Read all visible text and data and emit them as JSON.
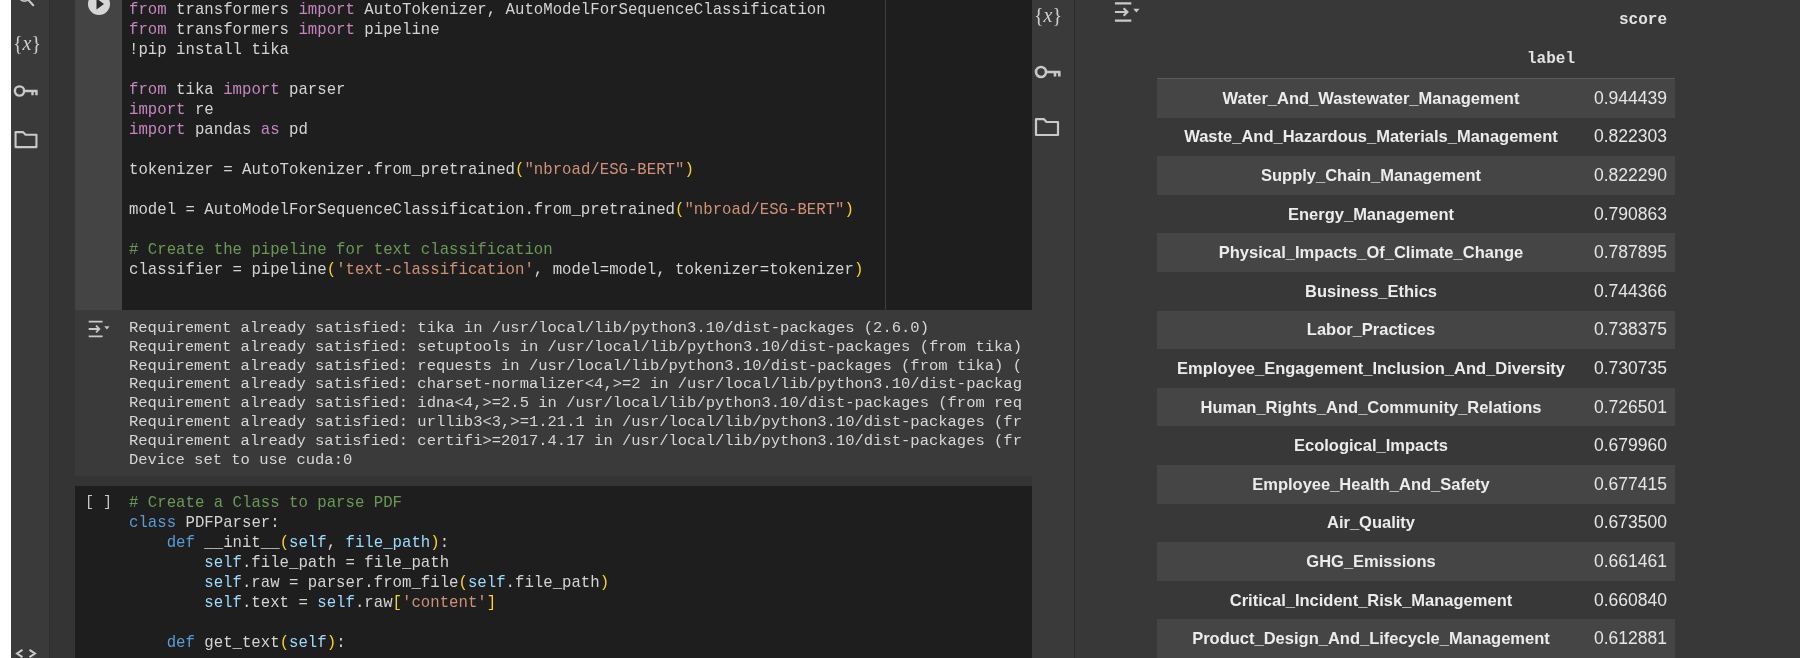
{
  "left_sidebar": {
    "variables_button": "{*x*}"
  },
  "cells": [
    {
      "focused": true,
      "code_lines": [
        {
          "kind": "code",
          "tokens": [
            {
              "kind": "keyword",
              "text": "from"
            },
            {
              "kind": "plain",
              "text": " transformers "
            },
            {
              "kind": "keyword",
              "text": "import"
            },
            {
              "kind": "plain",
              "text": " AutoTokenizer, AutoModelForSequenceClassification"
            }
          ]
        },
        {
          "kind": "code",
          "tokens": [
            {
              "kind": "keyword",
              "text": "from"
            },
            {
              "kind": "plain",
              "text": " transformers "
            },
            {
              "kind": "keyword",
              "text": "import"
            },
            {
              "kind": "plain",
              "text": " pipeline"
            }
          ]
        },
        {
          "kind": "code",
          "tokens": [
            {
              "kind": "plain",
              "text": "!pip install tika"
            }
          ]
        },
        {
          "kind": "blank"
        },
        {
          "kind": "code",
          "tokens": [
            {
              "kind": "keyword",
              "text": "from"
            },
            {
              "kind": "plain",
              "text": " tika "
            },
            {
              "kind": "keyword",
              "text": "import"
            },
            {
              "kind": "plain",
              "text": " parser"
            }
          ]
        },
        {
          "kind": "code",
          "tokens": [
            {
              "kind": "keyword",
              "text": "import"
            },
            {
              "kind": "plain",
              "text": " re"
            }
          ]
        },
        {
          "kind": "code",
          "tokens": [
            {
              "kind": "keyword",
              "text": "import"
            },
            {
              "kind": "plain",
              "text": " pandas "
            },
            {
              "kind": "keyword",
              "text": "as"
            },
            {
              "kind": "plain",
              "text": " pd"
            }
          ]
        },
        {
          "kind": "blank"
        },
        {
          "kind": "code",
          "tokens": [
            {
              "kind": "plain",
              "text": "tokenizer = AutoTokenizer.from_pretrained"
            },
            {
              "kind": "bracket",
              "text": "("
            },
            {
              "kind": "string",
              "text": "\"nbroad/ESG-BERT\""
            },
            {
              "kind": "bracket",
              "text": ")"
            }
          ]
        },
        {
          "kind": "blank"
        },
        {
          "kind": "code",
          "tokens": [
            {
              "kind": "plain",
              "text": "model = AutoModelForSequenceClassification.from_pretrained"
            },
            {
              "kind": "bracket",
              "text": "("
            },
            {
              "kind": "string",
              "text": "\"nbroad/ESG-BERT\""
            },
            {
              "kind": "bracket",
              "text": ")"
            }
          ]
        },
        {
          "kind": "blank"
        },
        {
          "kind": "code",
          "tokens": [
            {
              "kind": "comment",
              "text": "# Create the pipeline for text classification"
            }
          ]
        },
        {
          "kind": "code",
          "tokens": [
            {
              "kind": "plain",
              "text": "classifier = pipeline"
            },
            {
              "kind": "bracket",
              "text": "("
            },
            {
              "kind": "string",
              "text": "'text-classification'"
            },
            {
              "kind": "plain",
              "text": ", model=model, tokenizer=tokenizer"
            },
            {
              "kind": "bracket",
              "text": ")"
            }
          ]
        }
      ],
      "output": {
        "lines": [
          "Requirement already satisfied: tika in /usr/local/lib/python3.10/dist-packages (2.6.0)",
          "Requirement already satisfied: setuptools in /usr/local/lib/python3.10/dist-packages (from tika)",
          "Requirement already satisfied: requests in /usr/local/lib/python3.10/dist-packages (from tika) (",
          "Requirement already satisfied: charset-normalizer<4,>=2 in /usr/local/lib/python3.10/dist-packag",
          "Requirement already satisfied: idna<4,>=2.5 in /usr/local/lib/python3.10/dist-packages (from req",
          "Requirement already satisfied: urllib3<3,>=1.21.1 in /usr/local/lib/python3.10/dist-packages (fr",
          "Requirement already satisfied: certifi>=2017.4.17 in /usr/local/lib/python3.10/dist-packages (fr",
          "Device set to use cuda:0"
        ]
      }
    },
    {
      "focused": false,
      "execution_count": "[ ]",
      "code_lines": [
        {
          "kind": "code",
          "tokens": [
            {
              "kind": "comment",
              "text": "# Create a Class to parse PDF"
            }
          ]
        },
        {
          "kind": "code",
          "tokens": [
            {
              "kind": "declaration",
              "text": "class"
            },
            {
              "kind": "plain",
              "text": " PDFParser:"
            }
          ],
          "children": [
            {
              "kind": "code",
              "tokens": [
                {
                  "kind": "declaration",
                  "text": "def"
                },
                {
                  "kind": "plain",
                  "text": " __init__"
                },
                {
                  "kind": "bracket",
                  "text": "("
                },
                {
                  "kind": "variable",
                  "text": "self"
                },
                {
                  "kind": "plain",
                  "text": ", "
                },
                {
                  "kind": "variable",
                  "text": "file_path"
                },
                {
                  "kind": "bracket",
                  "text": ")"
                },
                {
                  "kind": "plain",
                  "text": ":"
                }
              ],
              "children": [
                {
                  "kind": "code",
                  "tokens": [
                    {
                      "kind": "variable",
                      "text": "self"
                    },
                    {
                      "kind": "plain",
                      "text": ".file_path = file_path"
                    }
                  ]
                },
                {
                  "kind": "code",
                  "tokens": [
                    {
                      "kind": "variable",
                      "text": "self"
                    },
                    {
                      "kind": "plain",
                      "text": ".raw = parser.from_file"
                    },
                    {
                      "kind": "bracket",
                      "text": "("
                    },
                    {
                      "kind": "variable",
                      "text": "self"
                    },
                    {
                      "kind": "plain",
                      "text": ".file_path"
                    },
                    {
                      "kind": "bracket",
                      "text": ")"
                    }
                  ]
                },
                {
                  "kind": "code",
                  "tokens": [
                    {
                      "kind": "variable",
                      "text": "self"
                    },
                    {
                      "kind": "plain",
                      "text": ".text = "
                    },
                    {
                      "kind": "variable",
                      "text": "self"
                    },
                    {
                      "kind": "plain",
                      "text": ".raw"
                    },
                    {
                      "kind": "bracket",
                      "text": "["
                    },
                    {
                      "kind": "string",
                      "text": "'content'"
                    },
                    {
                      "kind": "bracket",
                      "text": "]"
                    }
                  ]
                }
              ]
            },
            {
              "kind": "blank"
            },
            {
              "kind": "code",
              "tokens": [
                {
                  "kind": "declaration",
                  "text": "def"
                },
                {
                  "kind": "plain",
                  "text": " get_text"
                },
                {
                  "kind": "bracket",
                  "text": "("
                },
                {
                  "kind": "variable",
                  "text": "self"
                },
                {
                  "kind": "bracket",
                  "text": ")"
                },
                {
                  "kind": "plain",
                  "text": ":"
                }
              ]
            }
          ]
        }
      ]
    }
  ],
  "right_panel": {
    "sidebar": {
      "variables_button": "{*x*}"
    },
    "dataframe": {
      "columns": [
        "score"
      ],
      "index_name": "label",
      "rows": [
        {
          "label": "Water_And_Wastewater_Management",
          "score": "0.944439"
        },
        {
          "label": "Waste_And_Hazardous_Materials_Management",
          "score": "0.822303"
        },
        {
          "label": "Supply_Chain_Management",
          "score": "0.822290"
        },
        {
          "label": "Energy_Management",
          "score": "0.790863"
        },
        {
          "label": "Physical_Impacts_Of_Climate_Change",
          "score": "0.787895"
        },
        {
          "label": "Business_Ethics",
          "score": "0.744366"
        },
        {
          "label": "Labor_Practices",
          "score": "0.738375"
        },
        {
          "label": "Employee_Engagement_Inclusion_And_Diversity",
          "score": "0.730735"
        },
        {
          "label": "Human_Rights_And_Community_Relations",
          "score": "0.726501"
        },
        {
          "label": "Ecological_Impacts",
          "score": "0.679960"
        },
        {
          "label": "Employee_Health_And_Safety",
          "score": "0.677415"
        },
        {
          "label": "Air_Quality",
          "score": "0.673500"
        },
        {
          "label": "GHG_Emissions",
          "score": "0.661461"
        },
        {
          "label": "Critical_Incident_Risk_Management",
          "score": "0.660840"
        },
        {
          "label": "Product_Design_And_Lifecycle_Management",
          "score": "0.612881"
        }
      ]
    }
  }
}
